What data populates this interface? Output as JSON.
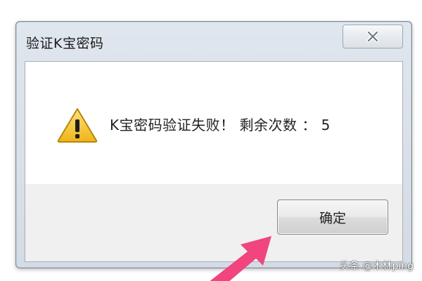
{
  "dialog": {
    "title": "验证K宝密码",
    "close_icon": "close-icon",
    "message": "K宝密码验证失败！ 剩余次数 ： 5",
    "warning_icon": "warning-icon",
    "ok_button_label": "确定"
  },
  "overlay": {
    "pointer_arrow_icon": "pointer-arrow-icon",
    "arrow_color": "#f0457e",
    "watermark": "头条 @木林ping"
  },
  "colors": {
    "warning_fill": "#f2c12e",
    "warning_stroke": "#c08a10",
    "frame": "#dfe6ee"
  }
}
